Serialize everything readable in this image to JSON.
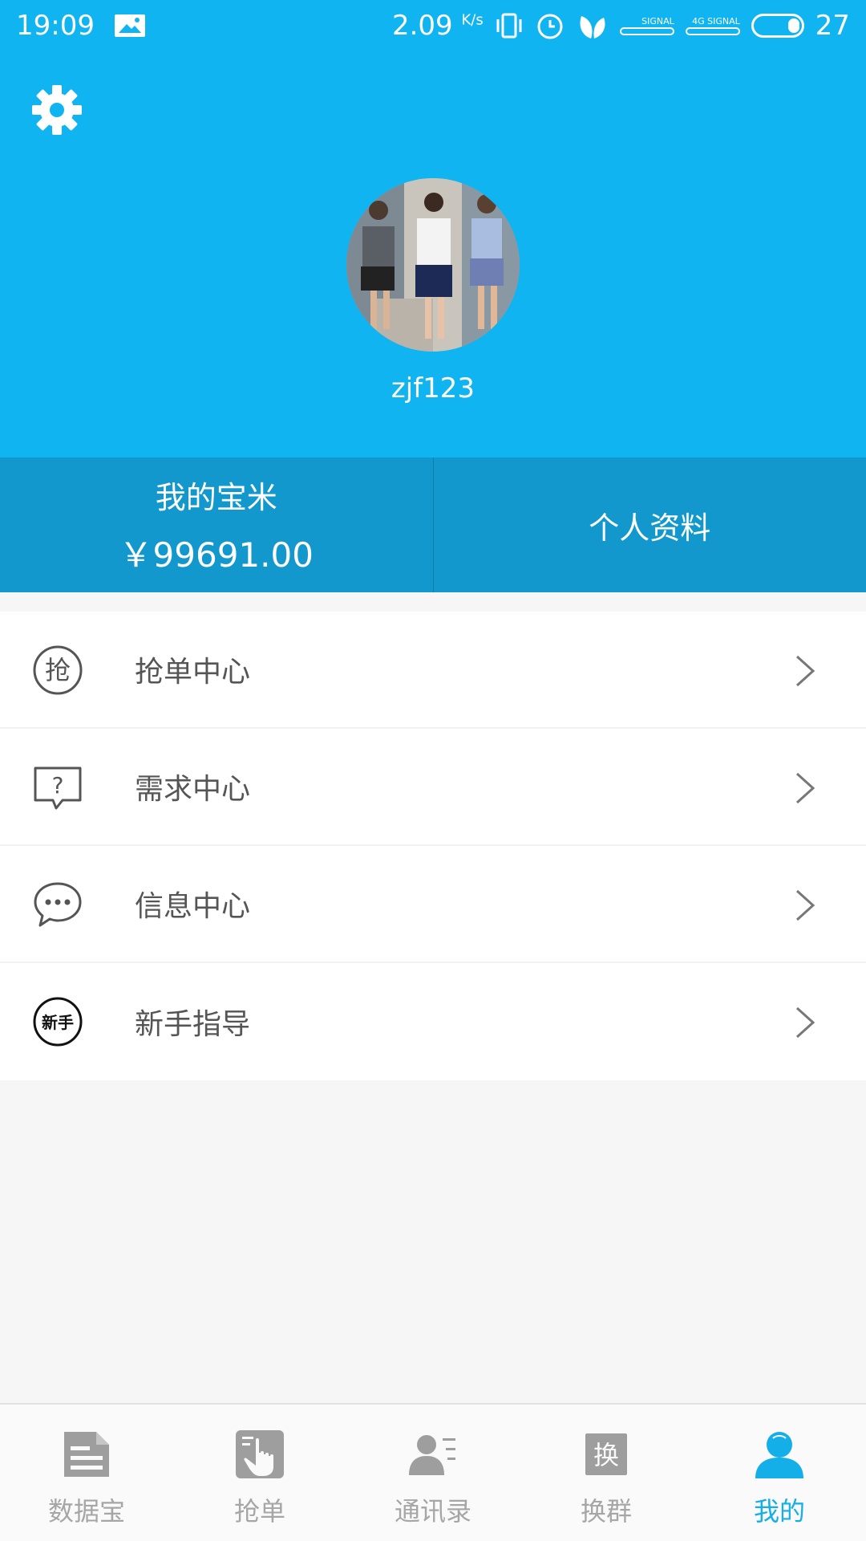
{
  "status_bar": {
    "time": "19:09",
    "net_speed": "2.09",
    "net_unit": "K/s",
    "sim1_label": "SIGNAL",
    "sim2_label": "4G SIGNAL",
    "battery": "27"
  },
  "header": {
    "settings_icon": "gear-icon",
    "username": "zjf123"
  },
  "strip": {
    "wallet_label": "我的宝米",
    "wallet_amount": "￥99691.00",
    "profile_label": "个人资料"
  },
  "menu": {
    "items": [
      {
        "label": "抢单中心",
        "icon": "grab-order-icon"
      },
      {
        "label": "需求中心",
        "icon": "question-bubble-icon"
      },
      {
        "label": "信息中心",
        "icon": "chat-bubble-icon"
      },
      {
        "label": "新手指导",
        "icon": "newbie-icon"
      }
    ]
  },
  "tabbar": {
    "tabs": [
      {
        "label": "数据宝",
        "icon": "document-icon"
      },
      {
        "label": "抢单",
        "icon": "hand-tap-icon"
      },
      {
        "label": "通讯录",
        "icon": "contacts-icon"
      },
      {
        "label": "换群",
        "icon": "swap-group-icon"
      },
      {
        "label": "我的",
        "icon": "person-icon",
        "active": true
      }
    ]
  },
  "colors": {
    "primary": "#10b4f0",
    "strip": "#1398cd",
    "active_tab": "#14aee9",
    "inactive_tab": "#a6a6a6"
  }
}
